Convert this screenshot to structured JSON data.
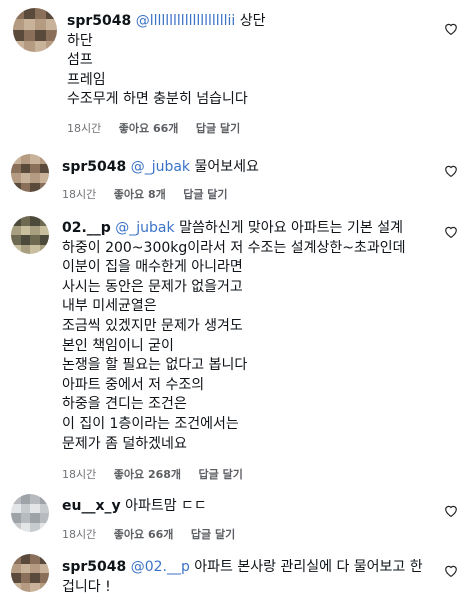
{
  "comments": [
    {
      "username": "spr5048",
      "mention": "@llllllllllllllllllllii",
      "lines": [
        "상단",
        "하단",
        "섬프",
        "프레임",
        "수조무게 하면 충분히 넘습니다"
      ],
      "time": "18시간",
      "likes": "좋아요 66개",
      "reply": "답글 달기",
      "avatar_colors": [
        "#8a6f5a",
        "#c9b29a",
        "#5a4a3c",
        "#b49b82"
      ]
    },
    {
      "username": "spr5048",
      "mention": "@_jubak",
      "lines": [
        "물어보세요"
      ],
      "time": "18시간",
      "likes": "좋아요 8개",
      "reply": "답글 달기",
      "avatar_colors": [
        "#8a6f5a",
        "#c9b29a",
        "#5a4a3c",
        "#b49b82"
      ]
    },
    {
      "username": "02.__p",
      "mention": "@_jubak",
      "lines": [
        "말씀하신게 맞아요 아파트는 기본 설계",
        "하중이 200~300kg이라서 저 수조는 설계상한~초과인데",
        "이분이 집을 매수한게 아니라면",
        "사시는 동안은 문제가 없을거고",
        "내부 미세균열은",
        "조금씩 있겠지만 문제가 생겨도",
        "본인 책임이니 굳이",
        "논쟁을 할 필요는 없다고 봅니다",
        "아파트 중에서 저 수조의",
        "하중을 견디는 조건은",
        "이 집이 1층이라는 조건에서는",
        "문제가 좀 덜하겠네요"
      ],
      "time": "18시간",
      "likes": "좋아요 268개",
      "reply": "답글 달기",
      "avatar_colors": [
        "#6e6a52",
        "#a89f80",
        "#4c4a3a",
        "#c7bf9e"
      ]
    },
    {
      "username": "eu__x_y",
      "mention": "",
      "lines": [
        "아파트맘 ㄷㄷ"
      ],
      "time": "18시간",
      "likes": "좋아요 66개",
      "reply": "답글 달기",
      "avatar_colors": [
        "#c8cbce",
        "#9ea3a8",
        "#e3e5e7",
        "#b7bbbf"
      ]
    },
    {
      "username": "spr5048",
      "mention": "@02.__p",
      "lines": [
        "아파트 본사랑 관리실에 다 물어보고 한",
        "겁니다 !"
      ],
      "time": "",
      "likes": "",
      "reply": "",
      "avatar_colors": [
        "#8a6f5a",
        "#c9b29a",
        "#5a4a3c",
        "#b49b82"
      ]
    }
  ]
}
